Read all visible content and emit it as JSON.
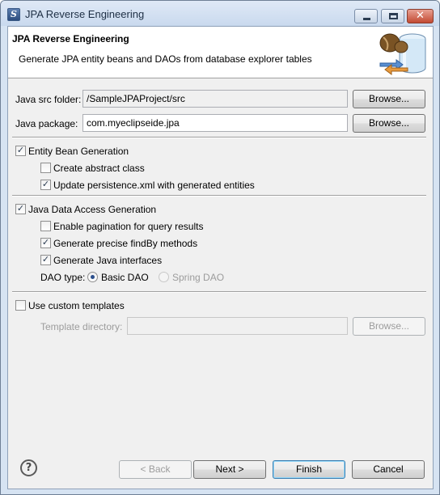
{
  "window": {
    "title": "JPA Reverse Engineering",
    "app_icon": "eclipse-icon",
    "controls": {
      "minimize": "minimize-icon",
      "maximize": "maximize-icon",
      "close": "close-icon",
      "close_glyph": "✕"
    }
  },
  "header": {
    "title": "JPA Reverse Engineering",
    "description": "Generate JPA entity beans and DAOs from database explorer tables",
    "banner_icon": "database-java-icon"
  },
  "form": {
    "src_folder": {
      "label": "Java src folder:",
      "value": "/SampleJPAProject/src",
      "browse": "Browse..."
    },
    "package": {
      "label": "Java package:",
      "value": "com.myeclipseide.jpa",
      "browse": "Browse..."
    }
  },
  "entity_section": {
    "main": {
      "label": "Entity Bean Generation",
      "checked": true
    },
    "options": [
      {
        "label": "Create abstract class",
        "checked": false
      },
      {
        "label": "Update persistence.xml with generated entities",
        "checked": true
      }
    ]
  },
  "dao_section": {
    "main": {
      "label": "Java Data Access Generation",
      "checked": true
    },
    "options": [
      {
        "label": "Enable pagination for query results",
        "checked": false
      },
      {
        "label": "Generate precise findBy methods",
        "checked": true
      },
      {
        "label": "Generate Java interfaces",
        "checked": true
      }
    ],
    "dao_type": {
      "label": "DAO type:",
      "options": [
        {
          "label": "Basic DAO",
          "selected": true,
          "enabled": true
        },
        {
          "label": "Spring DAO",
          "selected": false,
          "enabled": false
        }
      ]
    }
  },
  "templates": {
    "main": {
      "label": "Use custom templates",
      "checked": false
    },
    "dir_label": "Template directory:",
    "dir_value": "",
    "browse": "Browse..."
  },
  "footer": {
    "help_glyph": "?",
    "help_icon": "help-icon",
    "back": "< Back",
    "next": "Next >",
    "finish": "Finish",
    "cancel": "Cancel"
  },
  "check_glyph": "✓",
  "colors": {
    "title_bg": "#c9d9ee",
    "close_button": "#c34a32",
    "dialog_bg": "#f0f0f0",
    "header_bg": "#ffffff"
  }
}
